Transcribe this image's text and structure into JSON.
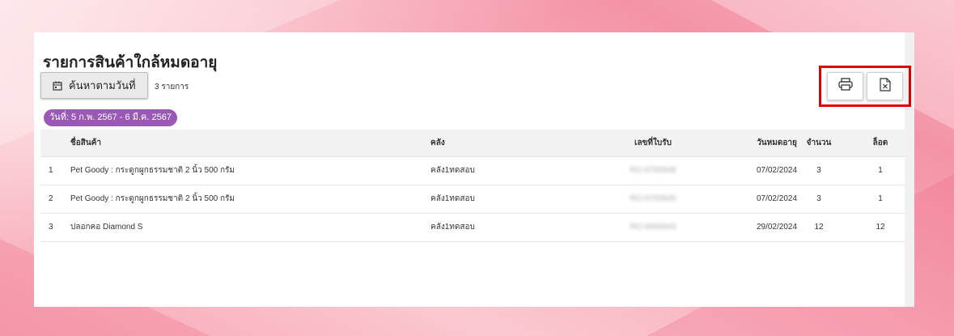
{
  "page": {
    "title": "รายการสินค้าใกล้หมดอายุ",
    "search_button": "ค้นหาตามวันที่",
    "count_label": "3 รายการ",
    "date_range": "วันที่: 5 ก.พ. 2567 - 6 มี.ค. 2567"
  },
  "toolbar": {
    "print_icon": "printer-icon",
    "excel_icon": "excel-export-icon",
    "highlight_color": "#e00000"
  },
  "colors": {
    "chip": "#9b59b6"
  },
  "table": {
    "headers": {
      "no": "",
      "name": "ชื่อสินค้า",
      "warehouse": "คลัง",
      "doc": "เลขที่ใบรับ",
      "expiry": "วันหมดอายุ",
      "qty": "จำนวน",
      "lot": "ล็อต"
    },
    "rows": [
      {
        "no": "1",
        "name": "Pet Goody : กระดูกผูกธรรมชาติ 2 นิ้ว 500 กรัม",
        "warehouse": "คลัง1ทดสอบ",
        "doc": "RO-6700948",
        "expiry": "07/02/2024",
        "qty": "3",
        "lot": "1"
      },
      {
        "no": "2",
        "name": "Pet Goody : กระดูกผูกธรรมชาติ 2 นิ้ว 500 กรัม",
        "warehouse": "คลัง1ทดสอบ",
        "doc": "RO-6700945",
        "expiry": "07/02/2024",
        "qty": "3",
        "lot": "1"
      },
      {
        "no": "3",
        "name": "ปลอกคอ Diamond S",
        "warehouse": "คลัง1ทดสอบ",
        "doc": "RO-6600943",
        "expiry": "29/02/2024",
        "qty": "12",
        "lot": "12"
      }
    ]
  }
}
